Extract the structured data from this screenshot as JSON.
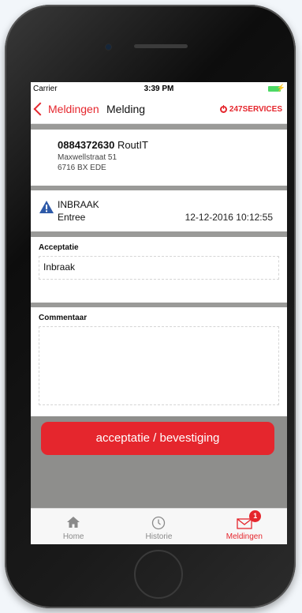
{
  "status_bar": {
    "carrier": "Carrier",
    "time": "3:39 PM"
  },
  "nav": {
    "back_label": "Meldingen",
    "title": "Melding",
    "brand": "247SERVICES"
  },
  "object": {
    "number": "0884372630",
    "owner": "RoutIT",
    "address_line1": "Maxwellstraat 51",
    "address_line2": "6716 BX EDE"
  },
  "alarm": {
    "icon": "warning-icon",
    "type": "INBRAAK",
    "zone": "Entree",
    "datetime": "12-12-2016 10:12:55"
  },
  "acceptatie": {
    "label": "Acceptatie",
    "value": "Inbraak"
  },
  "commentaar": {
    "label": "Commentaar",
    "value": ""
  },
  "action": {
    "label": "acceptatie / bevestiging"
  },
  "tabs": [
    {
      "label": "Home",
      "icon": "home-icon"
    },
    {
      "label": "Historie",
      "icon": "history-icon"
    },
    {
      "label": "Meldingen",
      "icon": "mail-icon",
      "badge": "1"
    }
  ],
  "colors": {
    "accent": "#e5262d",
    "separator": "#9a9a98",
    "action_bg": "#8e8e8c"
  }
}
